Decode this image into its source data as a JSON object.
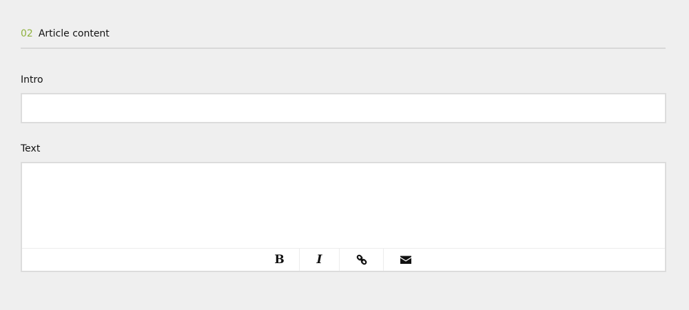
{
  "section": {
    "number": "02",
    "title": "Article content"
  },
  "fields": {
    "intro": {
      "label": "Intro",
      "value": ""
    },
    "text": {
      "label": "Text",
      "value": ""
    }
  },
  "toolbar": {
    "bold_glyph": "B",
    "italic_glyph": "I",
    "icons": [
      "bold-icon",
      "italic-icon",
      "link-icon",
      "envelope-icon"
    ]
  },
  "colors": {
    "accent": "#8fb13d",
    "background": "#efefef",
    "border": "#dcdcdc"
  }
}
